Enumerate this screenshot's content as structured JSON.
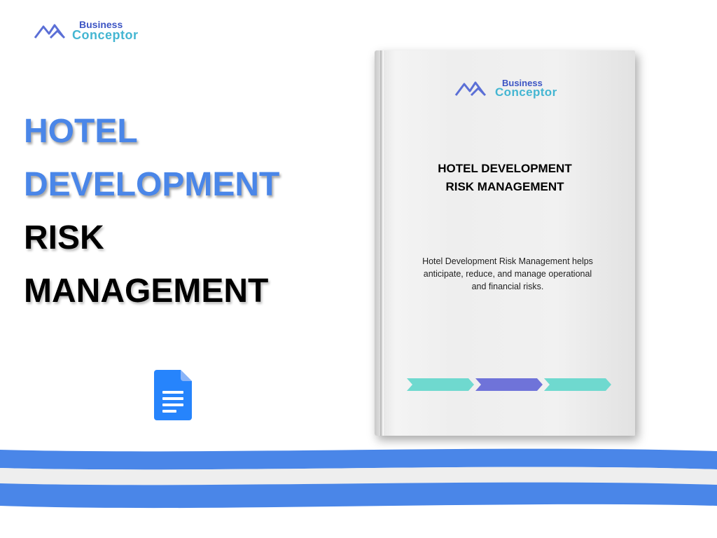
{
  "logo": {
    "line1": "Business",
    "line2": "Conceptor"
  },
  "title": {
    "line1": "HOTEL",
    "line2": "DEVELOPMENT",
    "line3": "RISK",
    "line4": "MANAGEMENT"
  },
  "book": {
    "logo_line1": "Business",
    "logo_line2": "Conceptor",
    "title_line1": "HOTEL DEVELOPMENT",
    "title_line2": "RISK MANAGEMENT",
    "description": "Hotel Development Risk Management helps anticipate, reduce, and manage operational and financial risks."
  },
  "colors": {
    "blue": "#4a86e8",
    "teal": "#6fd9cf",
    "purple": "#6f73d9",
    "logo_dark": "#3d55c4",
    "logo_light": "#44b6d2"
  },
  "icons": {
    "document": "google-docs-icon",
    "logo_mountain": "mountain-logo-icon"
  }
}
